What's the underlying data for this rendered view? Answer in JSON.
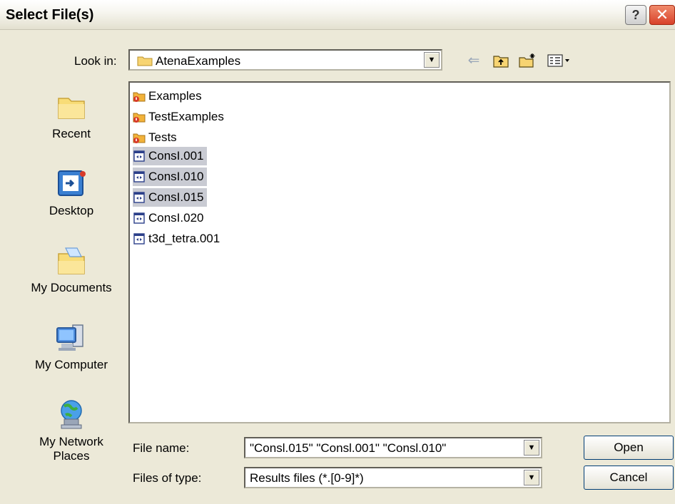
{
  "window": {
    "title": "Select File(s)"
  },
  "lookin": {
    "label": "Look in:",
    "value": "AtenaExamples"
  },
  "places": [
    {
      "label": "Recent",
      "icon": "recent-folder-icon"
    },
    {
      "label": "Desktop",
      "icon": "desktop-icon"
    },
    {
      "label": "My Documents",
      "icon": "my-documents-icon"
    },
    {
      "label": "My Computer",
      "icon": "my-computer-icon"
    },
    {
      "label": "My Network Places",
      "icon": "network-places-icon"
    }
  ],
  "files": [
    {
      "name": "Examples",
      "type": "folder",
      "selected": false
    },
    {
      "name": "TestExamples",
      "type": "folder",
      "selected": false
    },
    {
      "name": "Tests",
      "type": "folder",
      "selected": false
    },
    {
      "name": "ConsI.001",
      "type": "file",
      "selected": true
    },
    {
      "name": "ConsI.010",
      "type": "file",
      "selected": true
    },
    {
      "name": "ConsI.015",
      "type": "file",
      "selected": true
    },
    {
      "name": "ConsI.020",
      "type": "file",
      "selected": false
    },
    {
      "name": "t3d_tetra.001",
      "type": "file",
      "selected": false
    }
  ],
  "filename": {
    "label": "File name:",
    "value": "\"Consl.015\" \"Consl.001\" \"Consl.010\""
  },
  "filetype": {
    "label": "Files of type:",
    "value": "Results files (*.[0-9]*)"
  },
  "buttons": {
    "open": "Open",
    "cancel": "Cancel"
  },
  "colors": {
    "selection": "#c9cbd3",
    "dialog_bg": "#ece9d8"
  }
}
